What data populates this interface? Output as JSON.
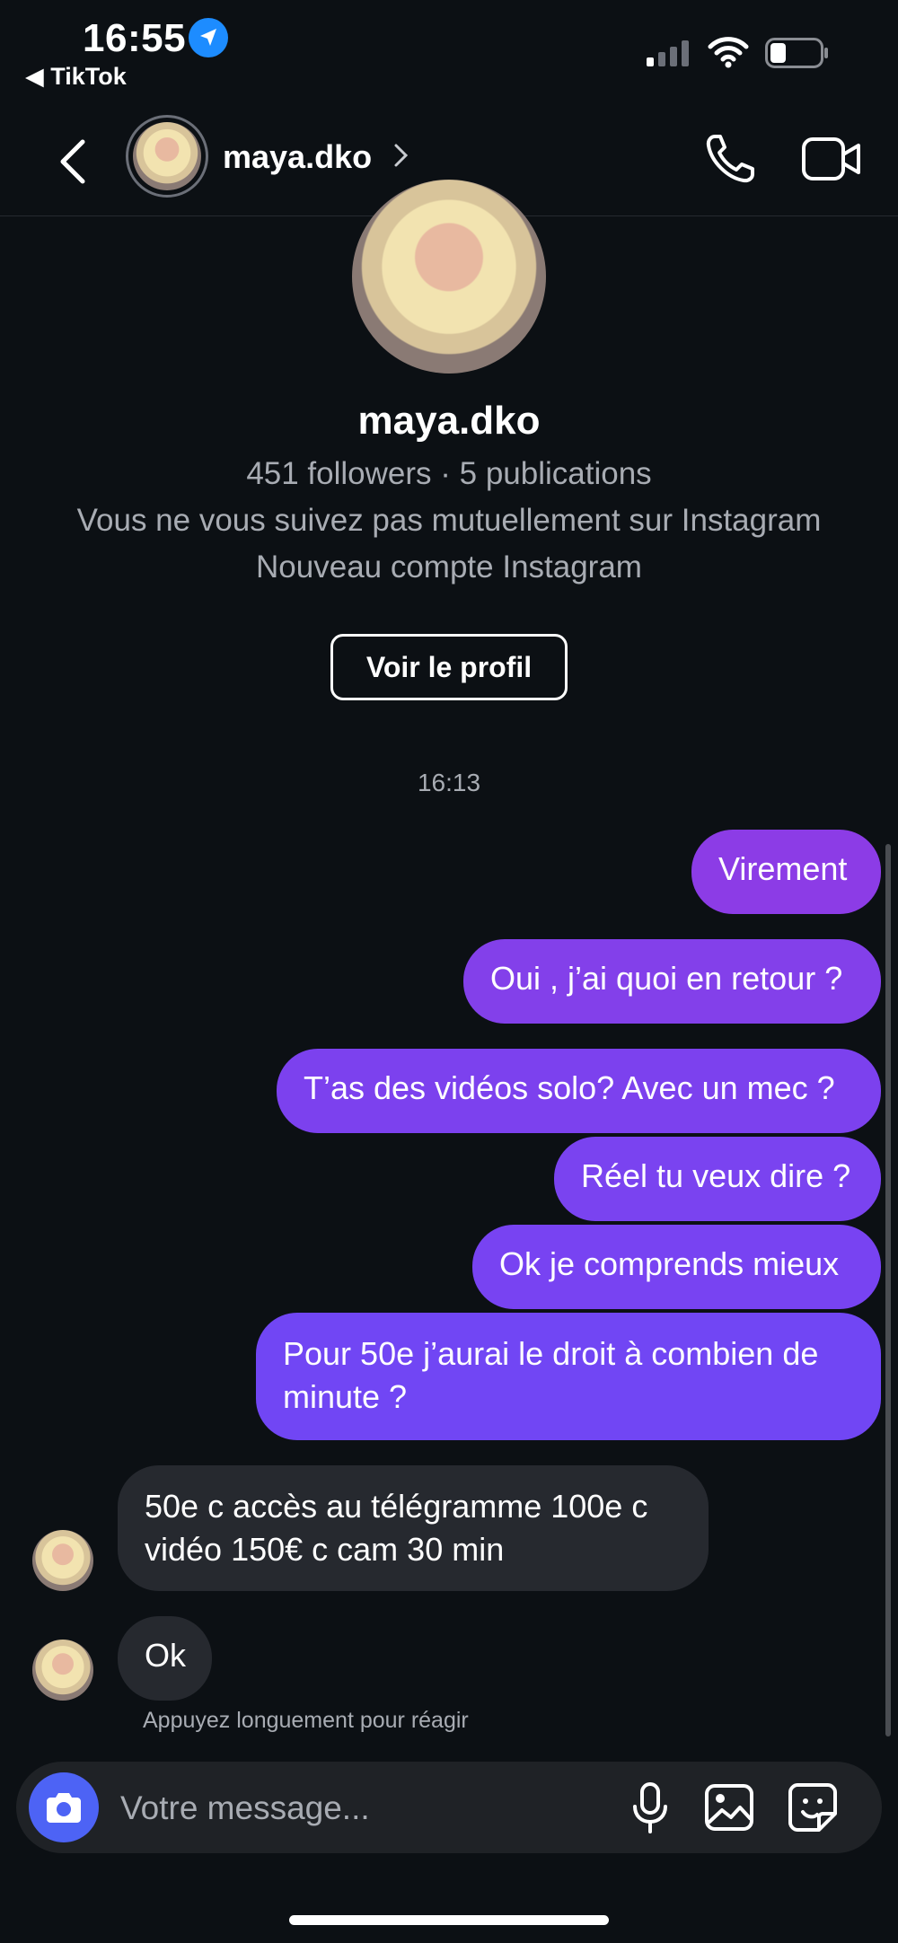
{
  "status_bar": {
    "time": "16:55",
    "back_app": "◀ TikTok"
  },
  "header": {
    "username": "maya.dko"
  },
  "profile": {
    "name": "maya.dko",
    "stats": "451 followers · 5 publications",
    "mutual": "Vous ne vous suivez pas mutuellement sur Instagram",
    "new_account": "Nouveau compte Instagram",
    "view_profile": "Voir le profil"
  },
  "thread": {
    "timestamp": "16:13",
    "sent": [
      "Virement",
      "Oui , j’ai quoi en retour ?",
      "T’as des vidéos solo? Avec un mec ?",
      "Réel tu veux dire ?",
      "Ok je comprends mieux",
      "Pour 50e j’aurai le droit à combien de minute ?"
    ],
    "received": [
      "50e c accès au télégramme 100e c vidéo 150€ c cam 30 min",
      "Ok"
    ],
    "hint": "Appuyez longuement pour réagir"
  },
  "composer": {
    "placeholder": "Votre message..."
  },
  "colors": {
    "background": "#0c1014",
    "sent_bubble": "#7a3cf0",
    "received_bubble": "#26292f",
    "camera_button": "#4d63f5"
  }
}
